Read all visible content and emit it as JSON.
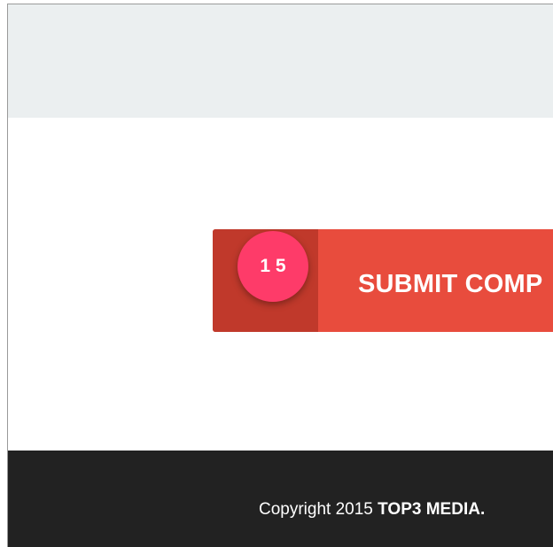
{
  "submit": {
    "label": "SUBMIT COMP"
  },
  "badge": {
    "text": "1 5"
  },
  "footer": {
    "copyright_prefix": "Copyright 2015 ",
    "brand": "TOP3 MEDIA."
  },
  "colors": {
    "top_band": "#ebeff0",
    "button": "#e84c3d",
    "button_icon_area": "#c0392b",
    "badge": "#fe3b69",
    "footer": "#222222"
  }
}
